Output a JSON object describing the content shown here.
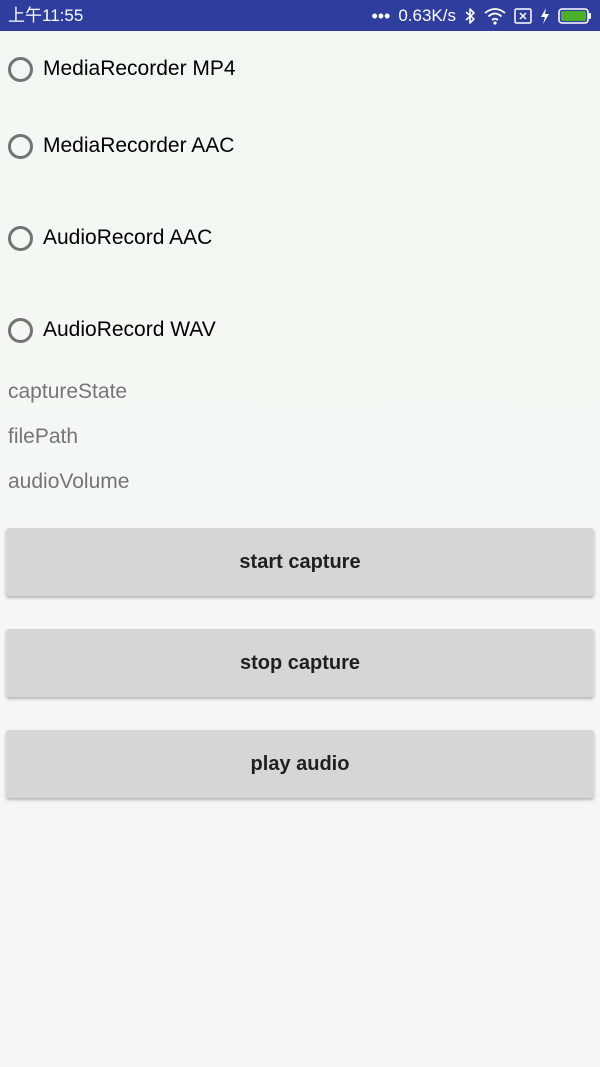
{
  "status_bar": {
    "time": "上午11:55",
    "dots": "•••",
    "net_speed": "0.63K/s",
    "icons": [
      "bluetooth-icon",
      "wifi-icon",
      "sim-off-icon",
      "charging-icon",
      "battery-icon"
    ],
    "color": "#2f3e9e"
  },
  "options": [
    {
      "label": "MediaRecorder MP4"
    },
    {
      "label": "MediaRecorder AAC"
    },
    {
      "label": "AudioRecord AAC"
    },
    {
      "label": "AudioRecord WAV"
    }
  ],
  "info": {
    "capture_state": "captureState",
    "file_path": "filePath",
    "audio_volume": "audioVolume"
  },
  "buttons": {
    "start_label": "start capture",
    "stop_label": "stop capture",
    "play_label": "play audio"
  },
  "colors": {
    "battery": "#4caf2a",
    "button_bg": "#d6d6d6"
  }
}
